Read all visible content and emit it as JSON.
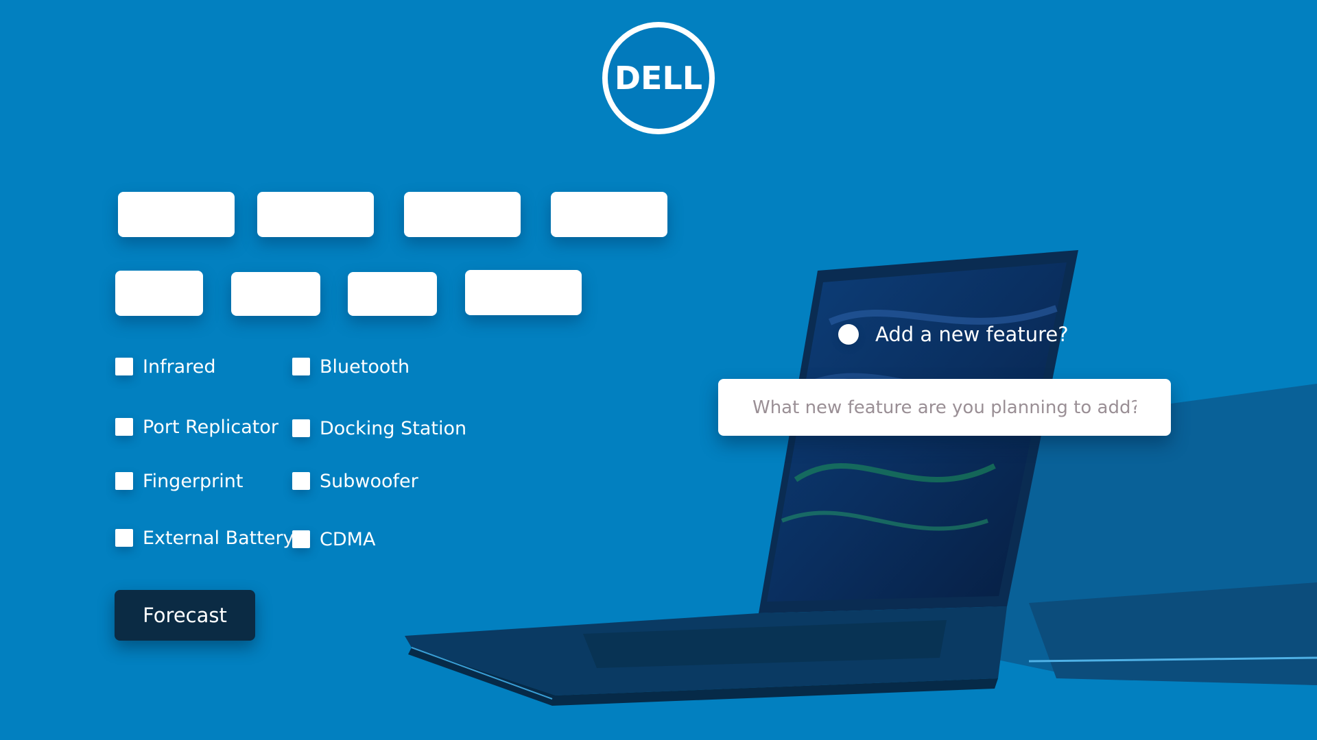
{
  "brand": {
    "logo_text": "DELL",
    "accent": "#0280c0"
  },
  "inputs": {
    "row1_count": 4,
    "row2_count": 4
  },
  "options": {
    "left": [
      "Infrared",
      "Port Replicator",
      "Fingerprint",
      "External Battery"
    ],
    "right": [
      "Bluetooth",
      "Docking Station",
      "Subwoofer",
      "CDMA"
    ]
  },
  "forecast_button": {
    "label": "Forecast",
    "color": "#0b2b44"
  },
  "new_feature": {
    "radio_label": "Add a new feature?",
    "placeholder": "What new feature are you planning to add?"
  }
}
